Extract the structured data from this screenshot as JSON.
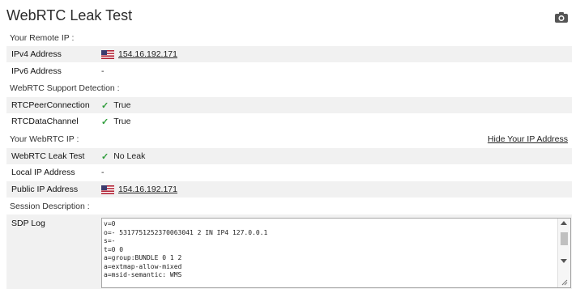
{
  "title": "WebRTC Leak Test",
  "camera_icon": "camera-icon",
  "sections": {
    "remote_ip": "Your Remote IP :",
    "support": "WebRTC Support Detection :",
    "webrtc_ip": "Your WebRTC IP :",
    "session": "Session Description :"
  },
  "hide_link": "Hide Your IP Address",
  "remote": {
    "ipv4_label": "IPv4 Address",
    "ipv4_value": "154.16.192.171",
    "ipv6_label": "IPv6 Address",
    "ipv6_value": "-"
  },
  "support": {
    "peer_label": "RTCPeerConnection",
    "peer_value": "True",
    "channel_label": "RTCDataChannel",
    "channel_value": "True"
  },
  "webrtc": {
    "leak_label": "WebRTC Leak Test",
    "leak_value": "No Leak",
    "local_label": "Local IP Address",
    "local_value": "-",
    "public_label": "Public IP Address",
    "public_value": "154.16.192.171"
  },
  "sdp": {
    "label": "SDP Log",
    "log": "v=0\no=- 5317751252370063041 2 IN IP4 127.0.0.1\ns=-\nt=0 0\na=group:BUNDLE 0 1 2\na=extmap-allow-mixed\na=msid-semantic: WMS"
  },
  "colors": {
    "check": "#2e9c3a",
    "row_shade": "#f1f1f1"
  }
}
